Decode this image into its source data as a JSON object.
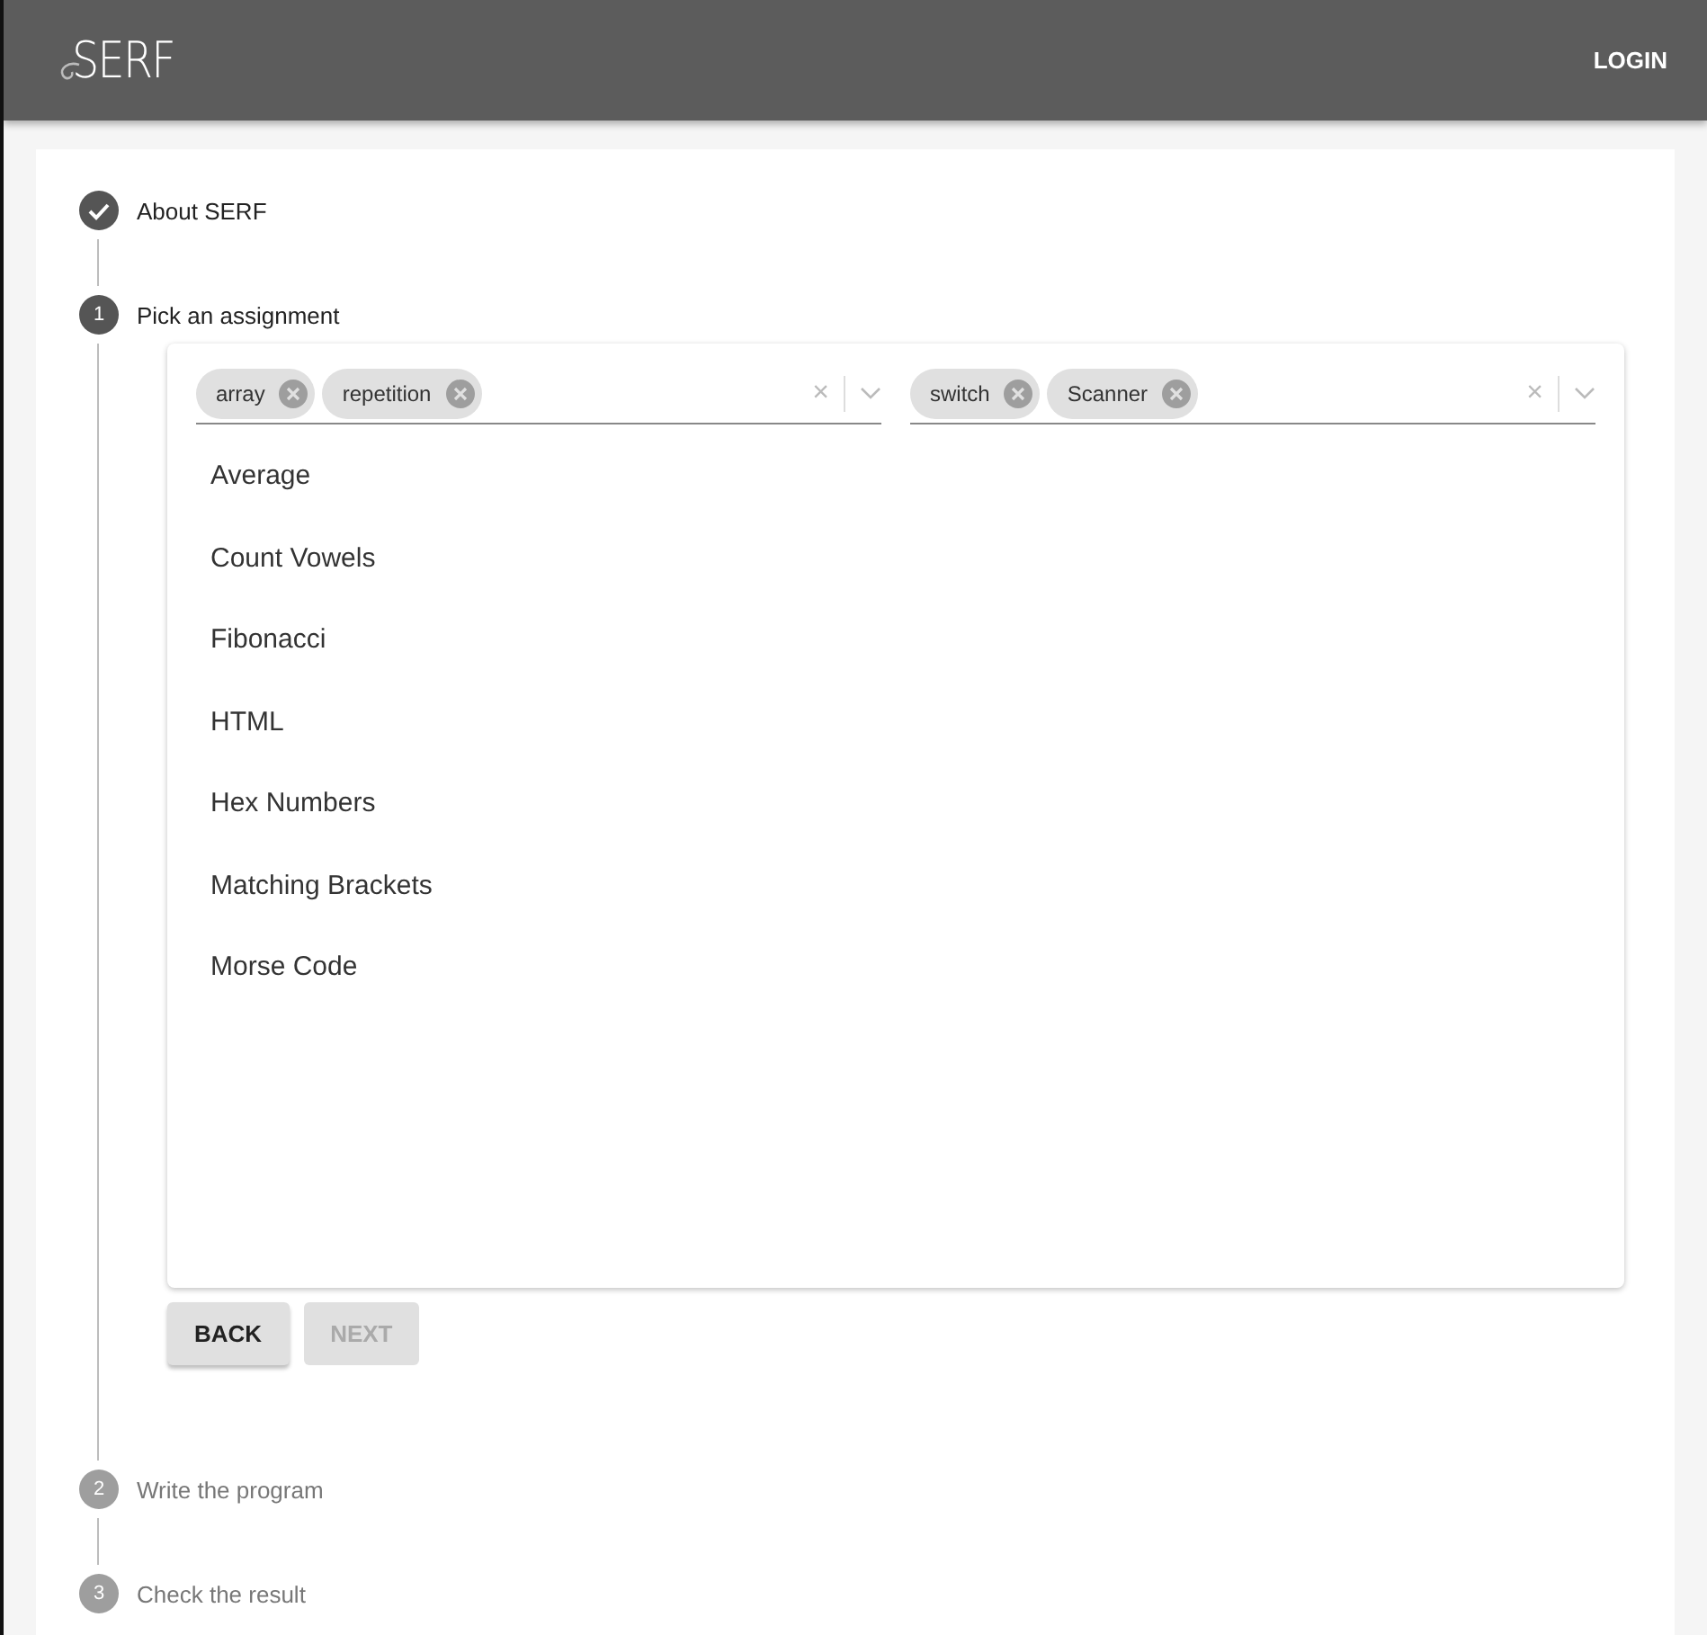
{
  "app_bar": {
    "logo": "SERF",
    "login": "LOGIN"
  },
  "steps": [
    {
      "kind": "done",
      "label": "About SERF"
    },
    {
      "kind": "active",
      "number": "1",
      "label": "Pick an assignment",
      "filters": [
        {
          "chips": [
            {
              "label": "array"
            },
            {
              "label": "repetition"
            }
          ],
          "clear": "×"
        },
        {
          "chips": [
            {
              "label": "switch"
            },
            {
              "label": "Scanner"
            }
          ],
          "clear": "×"
        }
      ],
      "assignments": [
        {
          "label": "Average"
        },
        {
          "label": "Count Vowels"
        },
        {
          "label": "Fibonacci"
        },
        {
          "label": "HTML"
        },
        {
          "label": "Hex Numbers"
        },
        {
          "label": "Matching Brackets"
        },
        {
          "label": "Morse Code"
        }
      ],
      "buttons": [
        {
          "label": "BACK",
          "disabled": false
        },
        {
          "label": "NEXT",
          "disabled": true
        }
      ]
    },
    {
      "kind": "pending",
      "number": "2",
      "label": "Write the program"
    },
    {
      "kind": "pending",
      "number": "3",
      "label": "Check the result"
    }
  ]
}
